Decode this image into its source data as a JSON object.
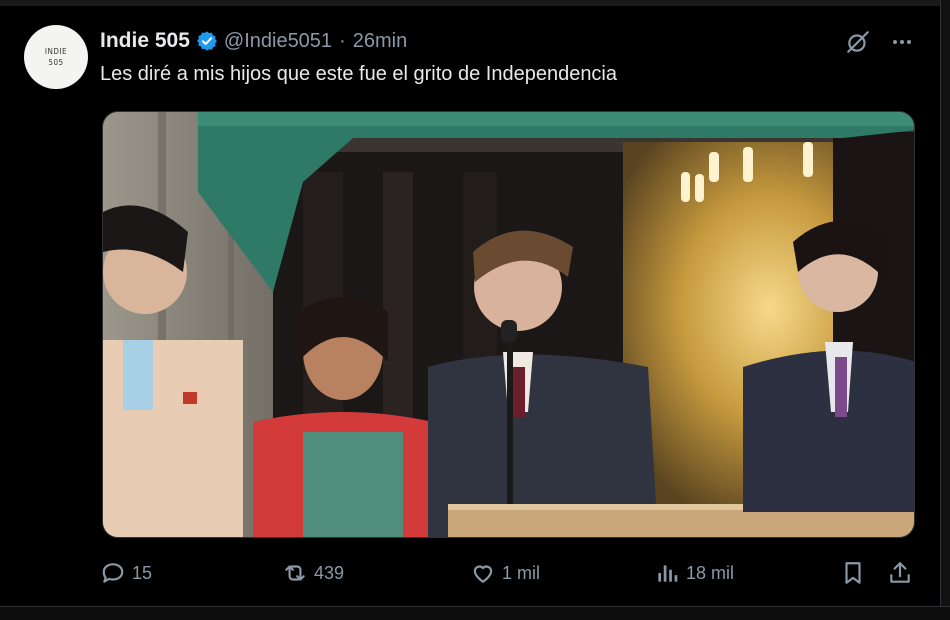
{
  "tweet": {
    "avatar_text_line1": "INDIE",
    "avatar_text_line2": "505",
    "display_name": "Indie 505",
    "verified_icon": "verified-badge-icon",
    "handle": "@Indie5051",
    "separator": "·",
    "time": "26min",
    "text": "Les diré a mis hijos que este fue el grito de Independencia"
  },
  "top_actions": {
    "grok_icon": "grok-icon",
    "more_icon": "more-icon"
  },
  "actions": {
    "reply_count": "15",
    "repost_count": "439",
    "like_count": "1 mil",
    "views_count": "18 mil",
    "reply_icon": "reply-icon",
    "repost_icon": "repost-icon",
    "like_icon": "like-icon",
    "views_icon": "views-icon",
    "bookmark_icon": "bookmark-icon",
    "share_icon": "share-icon"
  },
  "colors": {
    "background": "#000000",
    "text": "#e7e9ea",
    "muted": "#8b98a5",
    "verified": "#1d9bf0"
  }
}
